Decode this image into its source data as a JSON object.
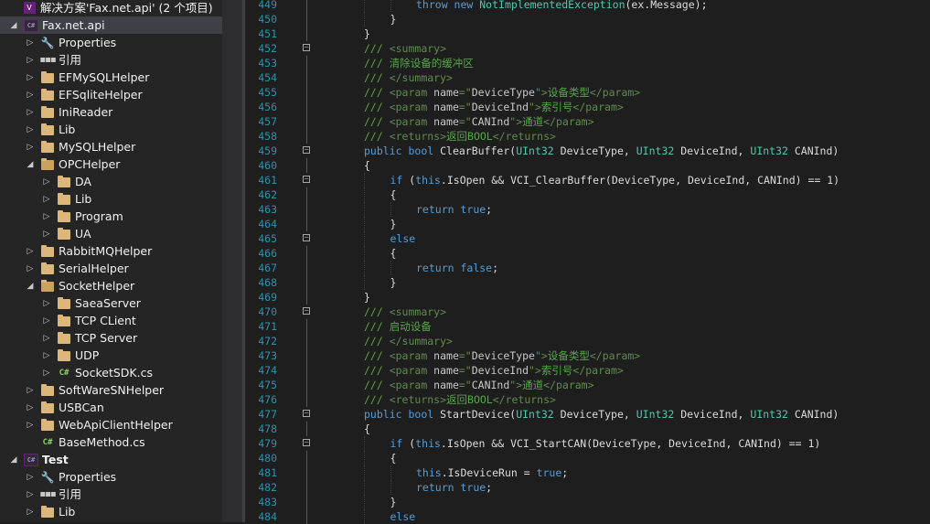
{
  "solution_explorer": {
    "rows": [
      {
        "label": "解决方案'Fax.net.api' (2 个项目)",
        "icon": "solution-icon",
        "expander": "none",
        "indent": 0
      },
      {
        "label": "Fax.net.api",
        "icon": "csharp-project-icon",
        "expander": "open",
        "indent": 0,
        "selected": true
      },
      {
        "label": "Properties",
        "icon": "wrench-icon",
        "expander": "closed",
        "indent": 1
      },
      {
        "label": "引用",
        "icon": "references-icon",
        "expander": "closed",
        "indent": 1
      },
      {
        "label": "EFMySQLHelper",
        "icon": "folder-icon",
        "expander": "closed",
        "indent": 1
      },
      {
        "label": "EFSqliteHelper",
        "icon": "folder-icon",
        "expander": "closed",
        "indent": 1
      },
      {
        "label": "IniReader",
        "icon": "folder-icon",
        "expander": "closed",
        "indent": 1
      },
      {
        "label": "Lib",
        "icon": "folder-icon",
        "expander": "closed",
        "indent": 1
      },
      {
        "label": "MySQLHelper",
        "icon": "folder-icon",
        "expander": "closed",
        "indent": 1
      },
      {
        "label": "OPCHelper",
        "icon": "folder-open-icon",
        "expander": "open",
        "indent": 1
      },
      {
        "label": "DA",
        "icon": "folder-icon",
        "expander": "closed",
        "indent": 2
      },
      {
        "label": "Lib",
        "icon": "folder-icon",
        "expander": "closed",
        "indent": 2
      },
      {
        "label": "Program",
        "icon": "folder-icon",
        "expander": "closed",
        "indent": 2
      },
      {
        "label": "UA",
        "icon": "folder-icon",
        "expander": "closed",
        "indent": 2
      },
      {
        "label": "RabbitMQHelper",
        "icon": "folder-icon",
        "expander": "closed",
        "indent": 1
      },
      {
        "label": "SerialHelper",
        "icon": "folder-icon",
        "expander": "closed",
        "indent": 1
      },
      {
        "label": "SocketHelper",
        "icon": "folder-open-icon",
        "expander": "open",
        "indent": 1
      },
      {
        "label": "SaeaServer",
        "icon": "folder-icon",
        "expander": "closed",
        "indent": 2
      },
      {
        "label": "TCP CLient",
        "icon": "folder-icon",
        "expander": "closed",
        "indent": 2
      },
      {
        "label": "TCP Server",
        "icon": "folder-icon",
        "expander": "closed",
        "indent": 2
      },
      {
        "label": "UDP",
        "icon": "folder-icon",
        "expander": "closed",
        "indent": 2
      },
      {
        "label": "SocketSDK.cs",
        "icon": "csharp-file-icon",
        "expander": "closed",
        "indent": 2
      },
      {
        "label": "SoftWareSNHelper",
        "icon": "folder-icon",
        "expander": "closed",
        "indent": 1
      },
      {
        "label": "USBCan",
        "icon": "folder-icon",
        "expander": "closed",
        "indent": 1
      },
      {
        "label": "WebApiClientHelper",
        "icon": "folder-icon",
        "expander": "closed",
        "indent": 1
      },
      {
        "label": "BaseMethod.cs",
        "icon": "csharp-file-icon",
        "expander": "none",
        "indent": 1
      },
      {
        "label": "Test",
        "icon": "csharp-project-icon",
        "expander": "open",
        "indent": 0,
        "bold": true
      },
      {
        "label": "Properties",
        "icon": "wrench-icon",
        "expander": "closed",
        "indent": 1
      },
      {
        "label": "引用",
        "icon": "references-icon",
        "expander": "closed",
        "indent": 1
      },
      {
        "label": "Lib",
        "icon": "folder-icon",
        "expander": "closed",
        "indent": 1
      }
    ]
  },
  "editor": {
    "colors": {
      "keyword": "#569cd6",
      "type": "#4ec9b0",
      "comment": "#57a64a",
      "xmltag": "#608b4e",
      "plain": "#dcdcdc",
      "linenumber": "#2b91af"
    },
    "lines": [
      {
        "n": "449",
        "indent": 2,
        "fold": "",
        "tokens": [
          [
            "kw",
            "throw "
          ],
          [
            "kw",
            "new "
          ],
          [
            "type",
            "NotImplementedException"
          ],
          [
            "pl",
            "(ex.Message);"
          ]
        ]
      },
      {
        "n": "450",
        "indent": 1,
        "fold": "",
        "tokens": [
          [
            "pl",
            "}"
          ]
        ]
      },
      {
        "n": "451",
        "indent": 0,
        "fold": "",
        "tokens": [
          [
            "pl",
            "}"
          ]
        ]
      },
      {
        "n": "452",
        "indent": 0,
        "fold": "minus",
        "tokens": [
          [
            "cm",
            "/// "
          ],
          [
            "tag",
            "<summary>"
          ]
        ]
      },
      {
        "n": "453",
        "indent": 0,
        "fold": "",
        "tokens": [
          [
            "cm",
            "/// 清除设备的缓冲区"
          ]
        ]
      },
      {
        "n": "454",
        "indent": 0,
        "fold": "",
        "tokens": [
          [
            "cm",
            "/// "
          ],
          [
            "tag",
            "</summary>"
          ]
        ]
      },
      {
        "n": "455",
        "indent": 0,
        "fold": "",
        "tokens": [
          [
            "cm",
            "/// "
          ],
          [
            "tag",
            "<param "
          ],
          [
            "attr",
            "name"
          ],
          [
            "tag",
            "=\""
          ],
          [
            "attr",
            "DeviceType"
          ],
          [
            "tag",
            "\">"
          ],
          [
            "cm",
            "设备类型"
          ],
          [
            "tag",
            "</param>"
          ]
        ]
      },
      {
        "n": "456",
        "indent": 0,
        "fold": "",
        "tokens": [
          [
            "cm",
            "/// "
          ],
          [
            "tag",
            "<param "
          ],
          [
            "attr",
            "name"
          ],
          [
            "tag",
            "=\""
          ],
          [
            "attr",
            "DeviceInd"
          ],
          [
            "tag",
            "\">"
          ],
          [
            "cm",
            "索引号"
          ],
          [
            "tag",
            "</param>"
          ]
        ]
      },
      {
        "n": "457",
        "indent": 0,
        "fold": "",
        "tokens": [
          [
            "cm",
            "/// "
          ],
          [
            "tag",
            "<param "
          ],
          [
            "attr",
            "name"
          ],
          [
            "tag",
            "=\""
          ],
          [
            "attr",
            "CANInd"
          ],
          [
            "tag",
            "\">"
          ],
          [
            "cm",
            "通道"
          ],
          [
            "tag",
            "</param>"
          ]
        ]
      },
      {
        "n": "458",
        "indent": 0,
        "fold": "",
        "tokens": [
          [
            "cm",
            "/// "
          ],
          [
            "tag",
            "<returns>"
          ],
          [
            "cm",
            "返回BOOL"
          ],
          [
            "tag",
            "</returns>"
          ]
        ]
      },
      {
        "n": "459",
        "indent": 0,
        "fold": "minus",
        "tokens": [
          [
            "kw",
            "public "
          ],
          [
            "kw",
            "bool "
          ],
          [
            "pl",
            "ClearBuffer("
          ],
          [
            "type",
            "UInt32"
          ],
          [
            "pl",
            " DeviceType, "
          ],
          [
            "type",
            "UInt32"
          ],
          [
            "pl",
            " DeviceInd, "
          ],
          [
            "type",
            "UInt32"
          ],
          [
            "pl",
            " CANInd)"
          ]
        ]
      },
      {
        "n": "460",
        "indent": 0,
        "fold": "",
        "tokens": [
          [
            "pl",
            "{"
          ]
        ]
      },
      {
        "n": "461",
        "indent": 1,
        "fold": "minus",
        "tokens": [
          [
            "kw",
            "if "
          ],
          [
            "pl",
            "("
          ],
          [
            "kw",
            "this"
          ],
          [
            "pl",
            ".IsOpen && VCI_ClearBuffer(DeviceType, DeviceInd, CANInd) == 1)"
          ]
        ]
      },
      {
        "n": "462",
        "indent": 1,
        "fold": "",
        "tokens": [
          [
            "pl",
            "{"
          ]
        ]
      },
      {
        "n": "463",
        "indent": 2,
        "fold": "",
        "tokens": [
          [
            "kw",
            "return "
          ],
          [
            "kw",
            "true"
          ],
          [
            "pl",
            ";"
          ]
        ]
      },
      {
        "n": "464",
        "indent": 1,
        "fold": "",
        "tokens": [
          [
            "pl",
            "}"
          ]
        ]
      },
      {
        "n": "465",
        "indent": 1,
        "fold": "minus",
        "tokens": [
          [
            "kw",
            "else"
          ]
        ]
      },
      {
        "n": "466",
        "indent": 1,
        "fold": "",
        "tokens": [
          [
            "pl",
            "{"
          ]
        ]
      },
      {
        "n": "467",
        "indent": 2,
        "fold": "",
        "tokens": [
          [
            "kw",
            "return "
          ],
          [
            "kw",
            "false"
          ],
          [
            "pl",
            ";"
          ]
        ]
      },
      {
        "n": "468",
        "indent": 1,
        "fold": "",
        "tokens": [
          [
            "pl",
            "}"
          ]
        ]
      },
      {
        "n": "469",
        "indent": 0,
        "fold": "",
        "tokens": [
          [
            "pl",
            "}"
          ]
        ]
      },
      {
        "n": "470",
        "indent": 0,
        "fold": "minus",
        "tokens": [
          [
            "cm",
            "/// "
          ],
          [
            "tag",
            "<summary>"
          ]
        ]
      },
      {
        "n": "471",
        "indent": 0,
        "fold": "",
        "tokens": [
          [
            "cm",
            "/// 启动设备"
          ]
        ]
      },
      {
        "n": "472",
        "indent": 0,
        "fold": "",
        "tokens": [
          [
            "cm",
            "/// "
          ],
          [
            "tag",
            "</summary>"
          ]
        ]
      },
      {
        "n": "473",
        "indent": 0,
        "fold": "",
        "tokens": [
          [
            "cm",
            "/// "
          ],
          [
            "tag",
            "<param "
          ],
          [
            "attr",
            "name"
          ],
          [
            "tag",
            "=\""
          ],
          [
            "attr",
            "DeviceType"
          ],
          [
            "tag",
            "\">"
          ],
          [
            "cm",
            "设备类型"
          ],
          [
            "tag",
            "</param>"
          ]
        ]
      },
      {
        "n": "474",
        "indent": 0,
        "fold": "",
        "tokens": [
          [
            "cm",
            "/// "
          ],
          [
            "tag",
            "<param "
          ],
          [
            "attr",
            "name"
          ],
          [
            "tag",
            "=\""
          ],
          [
            "attr",
            "DeviceInd"
          ],
          [
            "tag",
            "\">"
          ],
          [
            "cm",
            "索引号"
          ],
          [
            "tag",
            "</param>"
          ]
        ]
      },
      {
        "n": "475",
        "indent": 0,
        "fold": "",
        "tokens": [
          [
            "cm",
            "/// "
          ],
          [
            "tag",
            "<param "
          ],
          [
            "attr",
            "name"
          ],
          [
            "tag",
            "=\""
          ],
          [
            "attr",
            "CANInd"
          ],
          [
            "tag",
            "\">"
          ],
          [
            "cm",
            "通道"
          ],
          [
            "tag",
            "</param>"
          ]
        ]
      },
      {
        "n": "476",
        "indent": 0,
        "fold": "",
        "tokens": [
          [
            "cm",
            "/// "
          ],
          [
            "tag",
            "<returns>"
          ],
          [
            "cm",
            "返回BOOL"
          ],
          [
            "tag",
            "</returns>"
          ]
        ]
      },
      {
        "n": "477",
        "indent": 0,
        "fold": "minus",
        "tokens": [
          [
            "kw",
            "public "
          ],
          [
            "kw",
            "bool "
          ],
          [
            "pl",
            "StartDevice("
          ],
          [
            "type",
            "UInt32"
          ],
          [
            "pl",
            " DeviceType, "
          ],
          [
            "type",
            "UInt32"
          ],
          [
            "pl",
            " DeviceInd, "
          ],
          [
            "type",
            "UInt32"
          ],
          [
            "pl",
            " CANInd)"
          ]
        ]
      },
      {
        "n": "478",
        "indent": 0,
        "fold": "",
        "tokens": [
          [
            "pl",
            "{"
          ]
        ]
      },
      {
        "n": "479",
        "indent": 1,
        "fold": "minus",
        "tokens": [
          [
            "kw",
            "if "
          ],
          [
            "pl",
            "("
          ],
          [
            "kw",
            "this"
          ],
          [
            "pl",
            ".IsOpen && VCI_StartCAN(DeviceType, DeviceInd, CANInd) == 1)"
          ]
        ]
      },
      {
        "n": "480",
        "indent": 1,
        "fold": "",
        "tokens": [
          [
            "pl",
            "{"
          ]
        ]
      },
      {
        "n": "481",
        "indent": 2,
        "fold": "",
        "tokens": [
          [
            "kw",
            "this"
          ],
          [
            "pl",
            ".IsDeviceRun = "
          ],
          [
            "kw",
            "true"
          ],
          [
            "pl",
            ";"
          ]
        ]
      },
      {
        "n": "482",
        "indent": 2,
        "fold": "",
        "tokens": [
          [
            "kw",
            "return "
          ],
          [
            "kw",
            "true"
          ],
          [
            "pl",
            ";"
          ]
        ]
      },
      {
        "n": "483",
        "indent": 1,
        "fold": "",
        "tokens": [
          [
            "pl",
            "}"
          ]
        ]
      },
      {
        "n": "484",
        "indent": 1,
        "fold": "",
        "tokens": [
          [
            "kw",
            "else"
          ]
        ]
      }
    ]
  }
}
